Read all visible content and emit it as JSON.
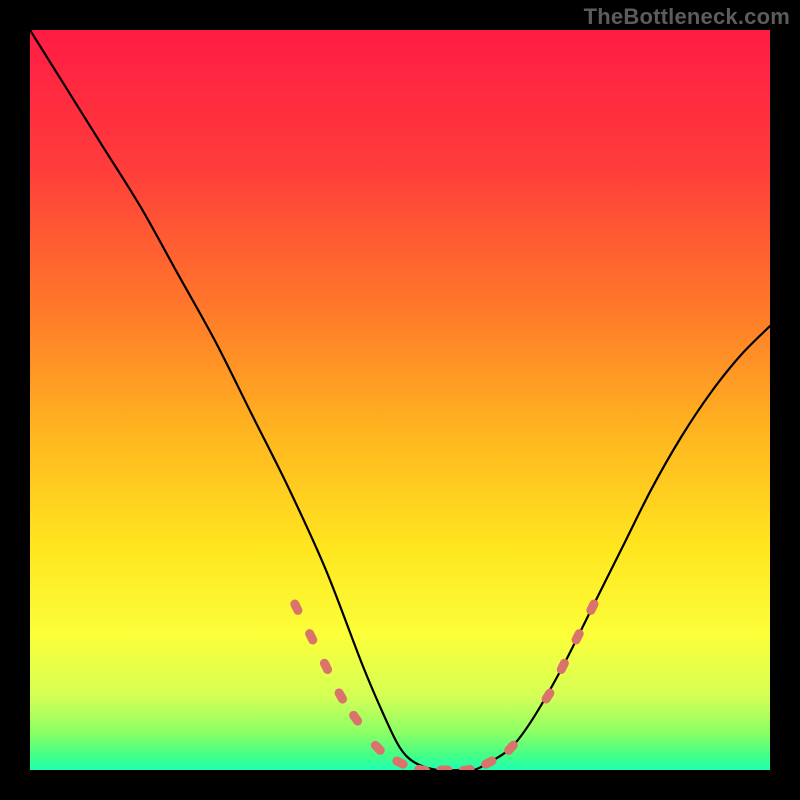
{
  "watermark": "TheBottleneck.com",
  "chart_data": {
    "type": "line",
    "title": "",
    "xlabel": "",
    "ylabel": "",
    "xlim": [
      0,
      100
    ],
    "ylim": [
      0,
      100
    ],
    "series": [
      {
        "name": "bottleneck-curve",
        "x": [
          0,
          5,
          10,
          15,
          20,
          25,
          30,
          35,
          40,
          45,
          48,
          50,
          52,
          55,
          58,
          60,
          62,
          65,
          68,
          72,
          76,
          80,
          84,
          88,
          92,
          96,
          100
        ],
        "y": [
          100,
          92,
          84,
          76,
          67,
          58,
          48,
          38,
          27,
          14,
          7,
          3,
          1,
          0,
          0,
          0,
          1,
          3,
          7,
          14,
          22,
          30,
          38,
          45,
          51,
          56,
          60
        ]
      }
    ],
    "markers": {
      "name": "highlighted-points",
      "color": "#d9736b",
      "points": [
        {
          "x": 36,
          "y": 22
        },
        {
          "x": 38,
          "y": 18
        },
        {
          "x": 40,
          "y": 14
        },
        {
          "x": 42,
          "y": 10
        },
        {
          "x": 44,
          "y": 7
        },
        {
          "x": 47,
          "y": 3
        },
        {
          "x": 50,
          "y": 1
        },
        {
          "x": 53,
          "y": 0
        },
        {
          "x": 56,
          "y": 0
        },
        {
          "x": 59,
          "y": 0
        },
        {
          "x": 62,
          "y": 1
        },
        {
          "x": 65,
          "y": 3
        },
        {
          "x": 70,
          "y": 10
        },
        {
          "x": 72,
          "y": 14
        },
        {
          "x": 74,
          "y": 18
        },
        {
          "x": 76,
          "y": 22
        }
      ]
    },
    "gradient_stops": [
      {
        "pct": 0,
        "color": "#ff1c44"
      },
      {
        "pct": 18,
        "color": "#ff3b3b"
      },
      {
        "pct": 38,
        "color": "#ff7a2a"
      },
      {
        "pct": 55,
        "color": "#ffb71f"
      },
      {
        "pct": 70,
        "color": "#ffe61f"
      },
      {
        "pct": 82,
        "color": "#fbff3a"
      },
      {
        "pct": 90,
        "color": "#d4ff55"
      },
      {
        "pct": 95,
        "color": "#8bff66"
      },
      {
        "pct": 98,
        "color": "#43ff86"
      },
      {
        "pct": 100,
        "color": "#1fffb0"
      }
    ]
  }
}
